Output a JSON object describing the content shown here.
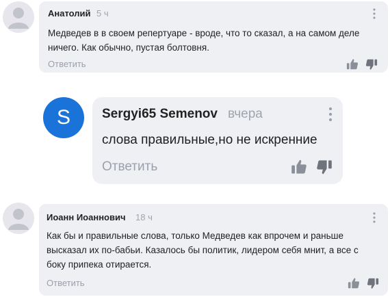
{
  "colors": {
    "bubble_bg": "#eff0f4",
    "avatar_letter_bg": "#1a73d9",
    "muted_text": "#a0a4ae",
    "icon_gray": "#8a8f99"
  },
  "icons": {
    "like": "thumbs-up-icon",
    "dislike": "thumbs-down-icon",
    "more": "vertical-dots-icon",
    "avatar": "default-user-avatar-icon"
  },
  "comments": [
    {
      "author": "Анатолий",
      "time": "5 ч",
      "text": "Медведев в в своем репертуаре - вроде, что то сказал, а на самом деле ничего.  Как обычно, пустая болтовня.",
      "reply_label": "Ответить"
    },
    {
      "avatar_letter": "S",
      "author": "Sergyi65 Semenov",
      "time": "вчера",
      "text": "слова правильные,но не искренние",
      "reply_label": "Ответить"
    },
    {
      "author": "Иоанн Иоаннович",
      "time": "18 ч",
      "text": "Как бы и правильные слова, только Медведев как впрочем и раньше высказал их по-бабьи. Казалось бы политик, лидером себя мнит, а все с боку припека отирается.",
      "reply_label": "Ответить"
    }
  ]
}
